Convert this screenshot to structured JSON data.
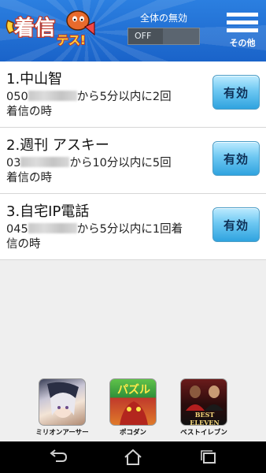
{
  "header": {
    "logo_text": "着信テス!",
    "master_label": "全体の無効",
    "master_value": "OFF",
    "menu_label": "その他",
    "menu_icon": "hamburger-icon",
    "accent_color": "#1a63c9"
  },
  "rules": [
    {
      "title": "1.中山智",
      "prefix": "050",
      "detail_before_line": "から5分以内に2回",
      "detail_after": "着信の時",
      "button_label": "有効"
    },
    {
      "title": "2.週刊 アスキー",
      "prefix": "03",
      "detail_before_line": "から10分以内に5回",
      "detail_after": "着信の時",
      "button_label": "有効"
    },
    {
      "title": "3.自宅IP電話",
      "prefix": "045",
      "detail_before_line": "から5分以内に1回着",
      "detail_after": "信の時",
      "button_label": "有効"
    }
  ],
  "apps": [
    {
      "label": "ミリオンアーサー",
      "icon": "million-arthur-app-icon"
    },
    {
      "label": "ポコダン",
      "icon": "pokodan-app-icon",
      "icon_text": "パズル"
    },
    {
      "label": "ベストイレブン",
      "icon": "best-eleven-app-icon",
      "icon_text": "BEST ELEVEN"
    }
  ],
  "navbar": {
    "icons": [
      "back-icon",
      "home-icon",
      "recent-apps-icon"
    ]
  }
}
